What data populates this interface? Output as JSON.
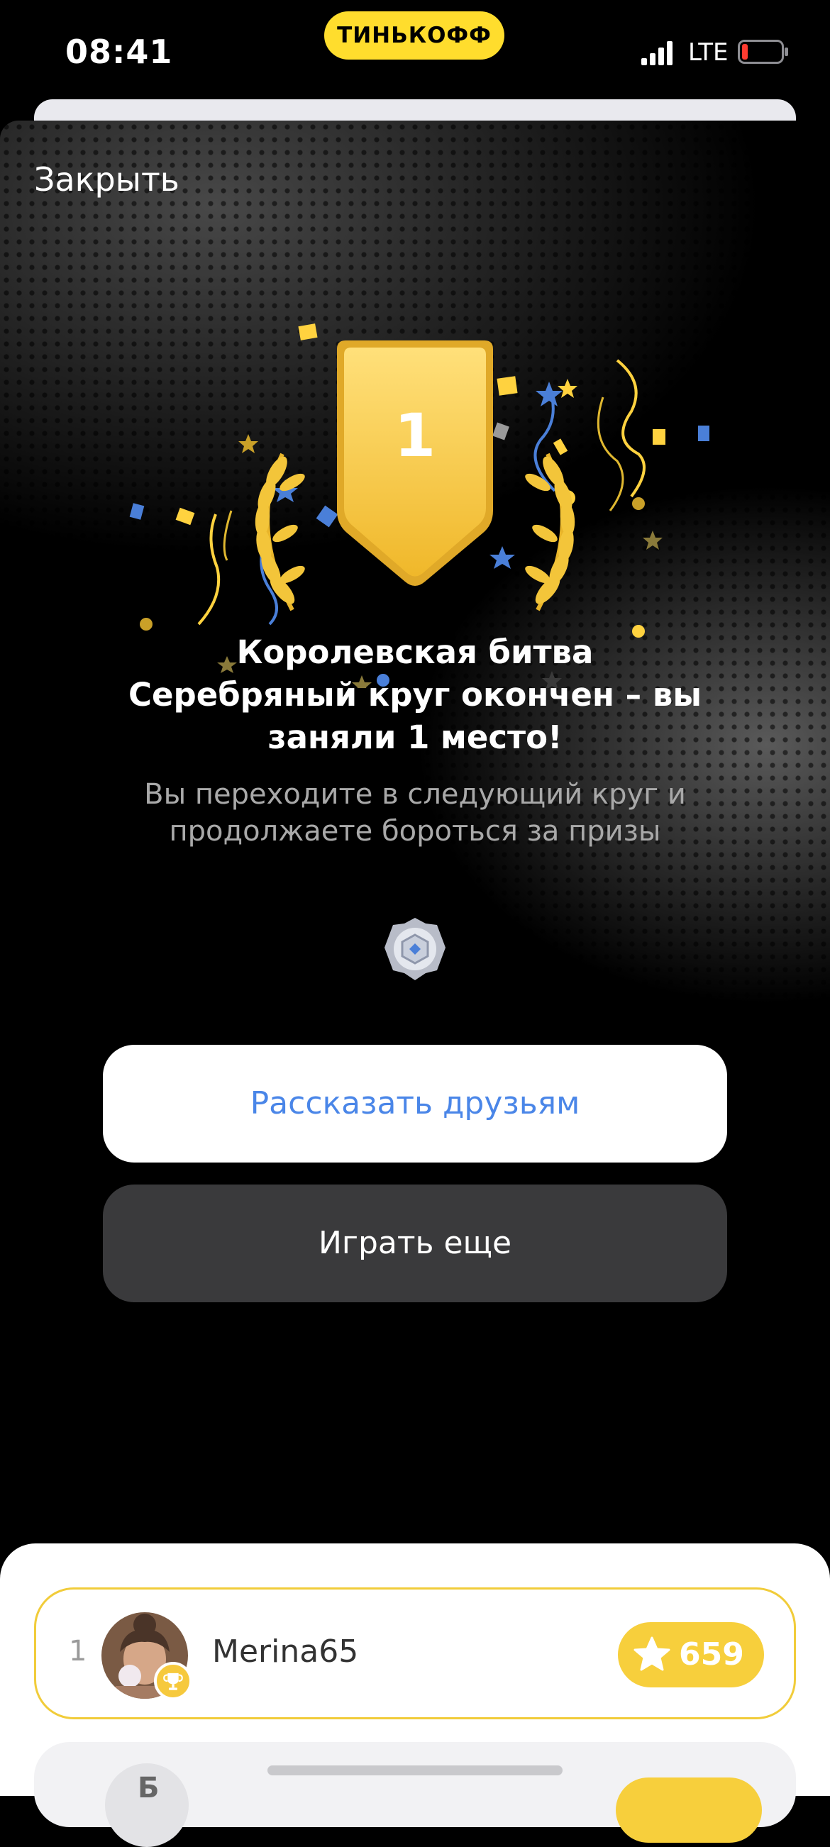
{
  "status_bar": {
    "time": "08:41",
    "brand": "ТИНЬКОФФ",
    "network": "LTE",
    "icons": [
      "signal-icon",
      "battery-low-icon"
    ]
  },
  "modal": {
    "close_label": "Закрыть",
    "title": "Королевская битва\nСеребряный круг окончен – вы\nзаняли 1 место!",
    "subtitle": "Вы переходите в следующий круг и\nпродолжаете бороться за призы",
    "place_number": "1",
    "share_button": "Рассказать друзьям",
    "replay_button": "Играть еще"
  },
  "leaderboard": {
    "rows": [
      {
        "rank": "1",
        "username": "Merina65",
        "score": "659"
      },
      {
        "avatar_letter": "Б"
      }
    ]
  },
  "colors": {
    "brand_yellow": "#ffdd2d",
    "accent_blue": "#4a86e8",
    "score_yellow": "#f7cf3c",
    "dark_button": "#3a3a3c"
  }
}
